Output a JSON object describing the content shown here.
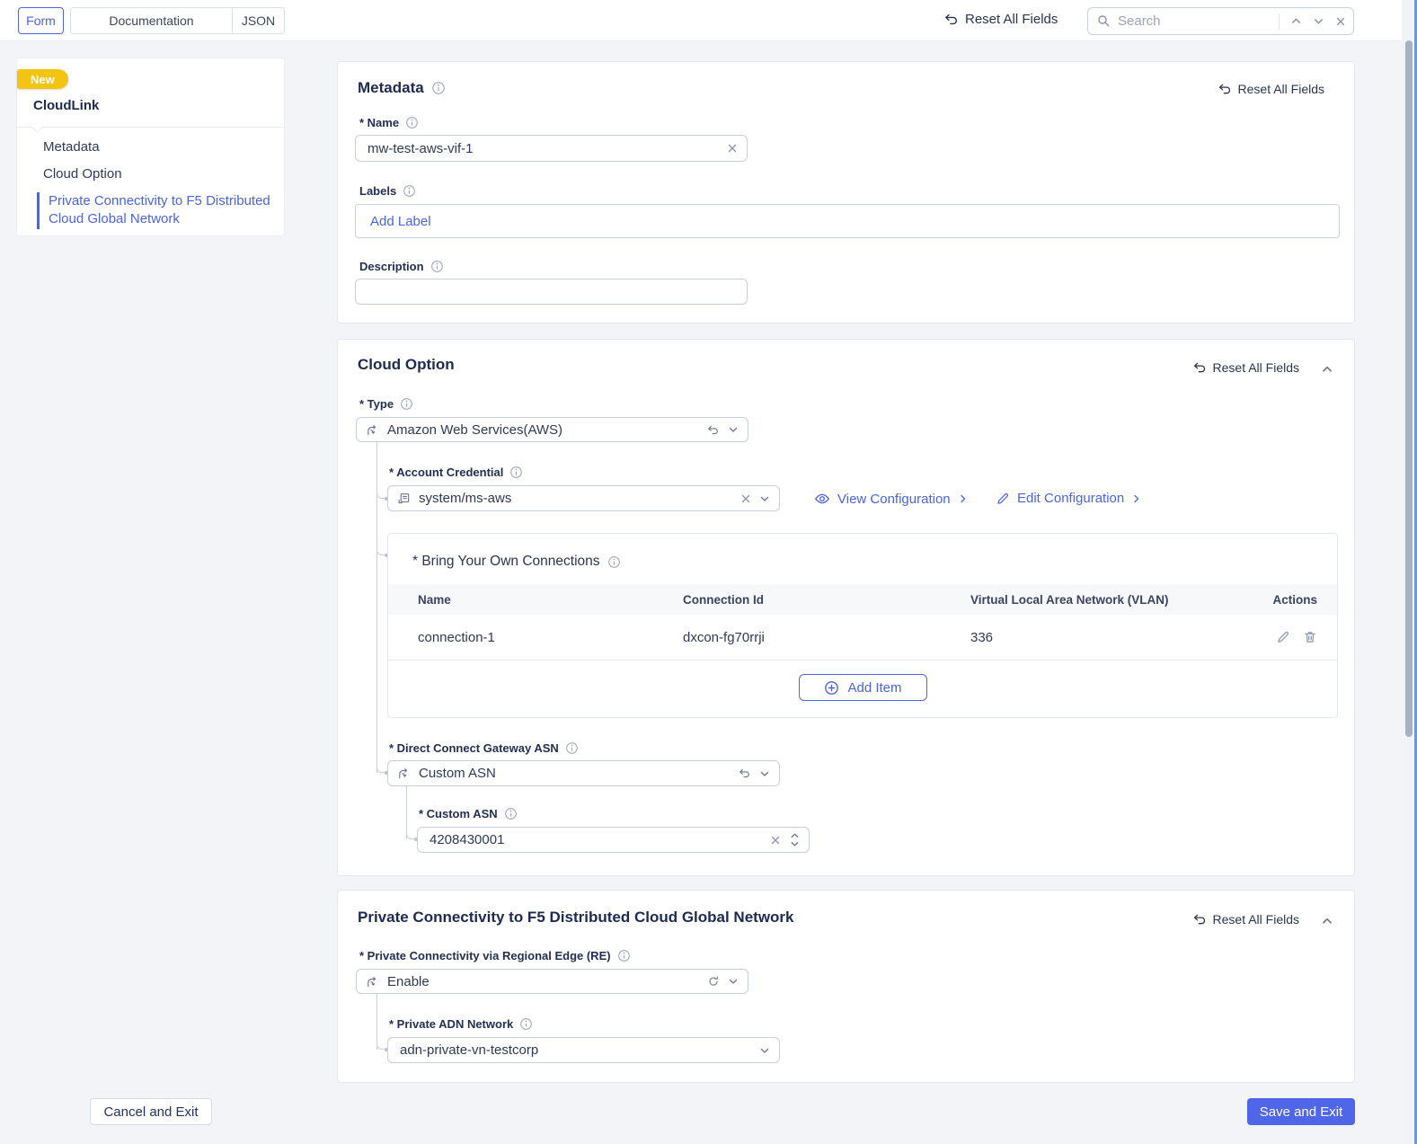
{
  "topbar": {
    "tabs": {
      "form": "Form",
      "documentation": "Documentation",
      "json": "JSON"
    },
    "reset_all": "Reset All Fields",
    "search": {
      "placeholder": "Search"
    }
  },
  "sidebar": {
    "badge": "New",
    "title": "CloudLink",
    "items": [
      {
        "label": "Metadata"
      },
      {
        "label": "Cloud Option"
      },
      {
        "label": "Private Connectivity to F5 Distributed Cloud Global Network"
      }
    ]
  },
  "metadata_card": {
    "title": "Metadata",
    "reset": "Reset All Fields",
    "name_label": "* Name",
    "name_value": "mw-test-aws-vif-1",
    "labels_label": "Labels",
    "labels_placeholder": "Add Label",
    "description_label": "Description",
    "description_value": ""
  },
  "cloud_option_card": {
    "title": "Cloud Option",
    "reset": "Reset All Fields",
    "type_label": "* Type",
    "type_value": "Amazon Web Services(AWS)",
    "account_credential_label": "* Account Credential",
    "account_credential_value": "system/ms-aws",
    "view_configuration": "View Configuration",
    "edit_configuration": "Edit Configuration",
    "byoc": {
      "title": "* Bring Your Own Connections",
      "columns": [
        "Name",
        "Connection Id",
        "Virtual Local Area Network (VLAN)",
        "Actions"
      ],
      "rows": [
        {
          "name": "connection-1",
          "connection_id": "dxcon-fg70rrji",
          "vlan": "336"
        }
      ],
      "add_item": "Add Item"
    },
    "dcg_asn_label": "* Direct Connect Gateway ASN",
    "dcg_asn_value": "Custom ASN",
    "custom_asn_label": "* Custom ASN",
    "custom_asn_value": "4208430001"
  },
  "private_connectivity_card": {
    "title": "Private Connectivity to F5 Distributed Cloud Global Network",
    "reset": "Reset All Fields",
    "re_label": "* Private Connectivity via Regional Edge (RE)",
    "re_value": "Enable",
    "adn_label": "* Private ADN Network",
    "adn_value": "adn-private-vn-testcorp"
  },
  "footer": {
    "cancel": "Cancel and Exit",
    "save": "Save and Exit"
  },
  "colors": {
    "accent": "#4a63e7",
    "badge_yellow": "#f3c411",
    "navy": "#1e2a52"
  }
}
